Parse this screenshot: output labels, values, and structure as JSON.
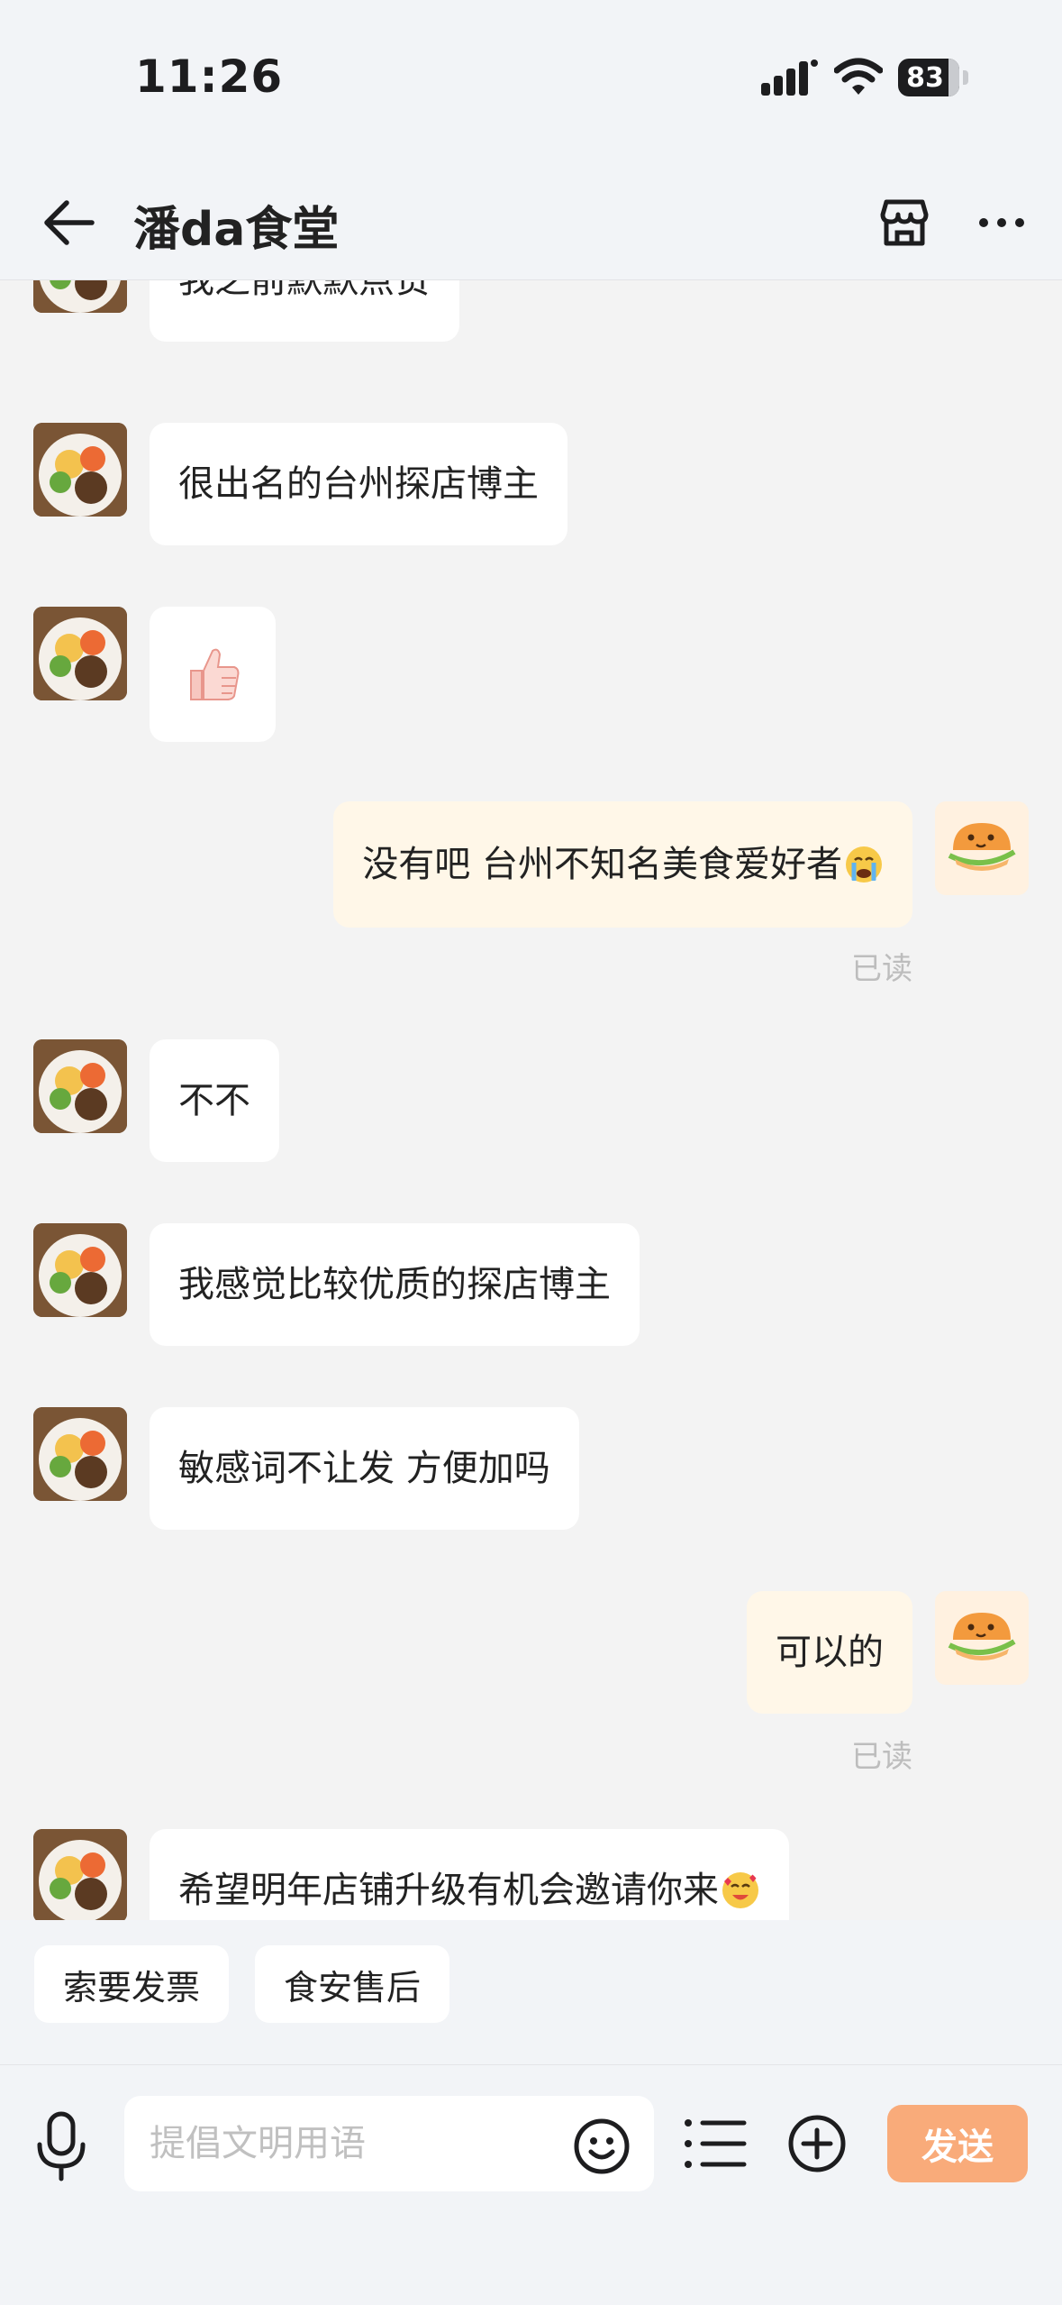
{
  "status_bar": {
    "time": "11:26",
    "battery": "83"
  },
  "nav": {
    "title": "潘da食堂"
  },
  "messages": [
    {
      "side": "in",
      "text": "我之前默默点赞"
    },
    {
      "side": "in",
      "text": "很出名的台州探店博主"
    },
    {
      "side": "in",
      "text": "",
      "emoji": "thumbs-up"
    },
    {
      "side": "out",
      "text": "没有吧 台州不知名美食爱好者",
      "emoji": "crying-face",
      "status": "已读"
    },
    {
      "side": "in",
      "text": "不不"
    },
    {
      "side": "in",
      "text": "我感觉比较优质的探店博主"
    },
    {
      "side": "in",
      "text": "敏感词不让发 方便加吗"
    },
    {
      "side": "out",
      "text": "可以的",
      "status": "已读"
    },
    {
      "side": "in",
      "text": "希望明年店铺升级有机会邀请你来",
      "emoji": "smiling-face-with-hearts"
    }
  ],
  "quick_replies": [
    "索要发票",
    "食安售后"
  ],
  "input": {
    "placeholder": "提倡文明用语",
    "value": ""
  },
  "send_label": "发送",
  "colors": {
    "send": "#f9ab7a",
    "outgoing_bubble": "#fff7e8",
    "incoming_bubble": "#ffffff"
  }
}
